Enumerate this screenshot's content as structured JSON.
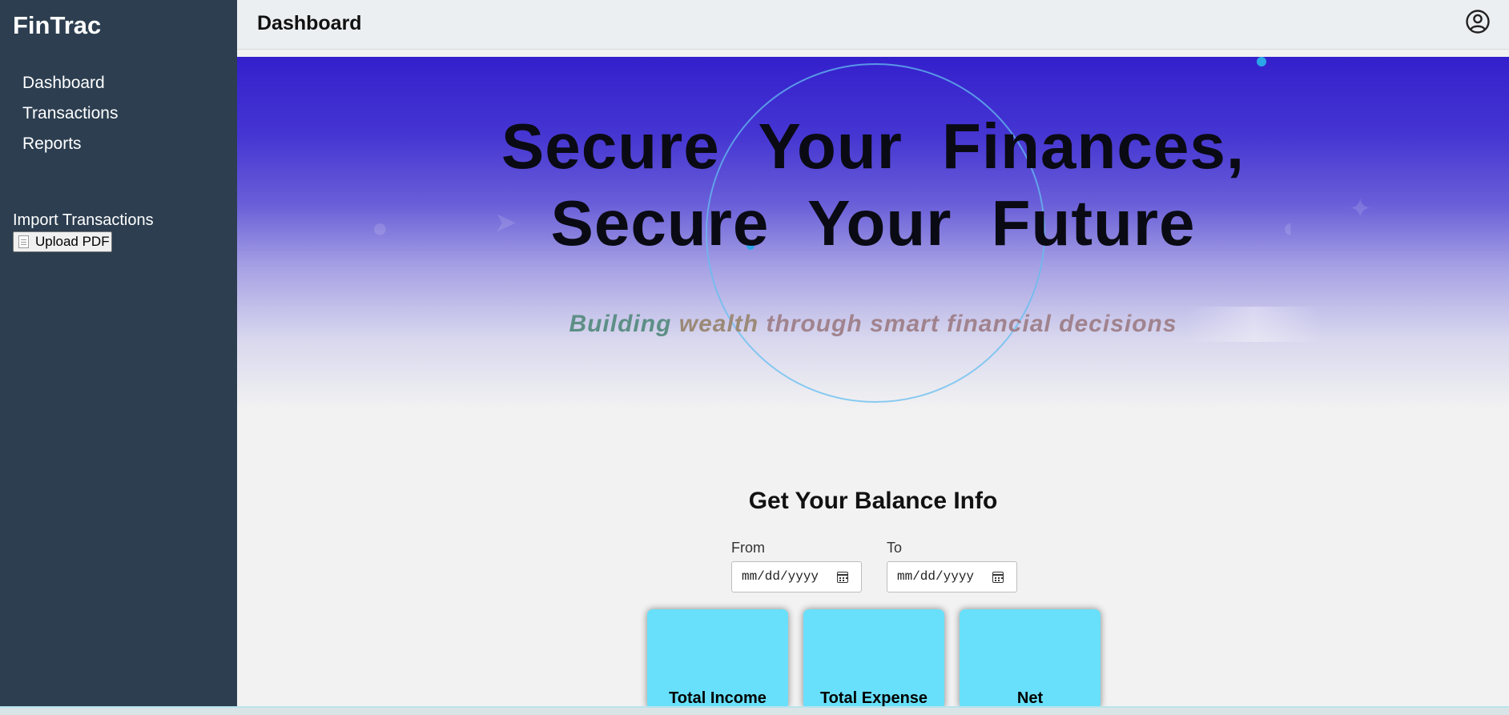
{
  "app": {
    "brand": "FinTrac"
  },
  "sidebar": {
    "items": [
      {
        "label": "Dashboard"
      },
      {
        "label": "Transactions"
      },
      {
        "label": "Reports"
      }
    ],
    "import_title": "Import Transactions",
    "upload_label": "Upload PDF"
  },
  "header": {
    "title": "Dashboard",
    "user_icon": "user-circle-icon"
  },
  "hero": {
    "headline_line1": "Secure Your Finances,",
    "headline_line2": "Secure Your Future",
    "tagline": {
      "w1": "Building",
      "w2": "wealth",
      "w3": "through smart financial decisions"
    }
  },
  "balance": {
    "title": "Get Your Balance Info",
    "from_label": "From",
    "to_label": "To",
    "from_placeholder": "mm/dd/yyyy",
    "to_placeholder": "mm/dd/yyyy",
    "cards": [
      {
        "label": "Total Income"
      },
      {
        "label": "Total Expense"
      },
      {
        "label": "Net"
      }
    ]
  },
  "colors": {
    "sidebar_bg": "#2c3e50",
    "hero_top": "#3420cc",
    "card_bg": "#68e0fb"
  }
}
